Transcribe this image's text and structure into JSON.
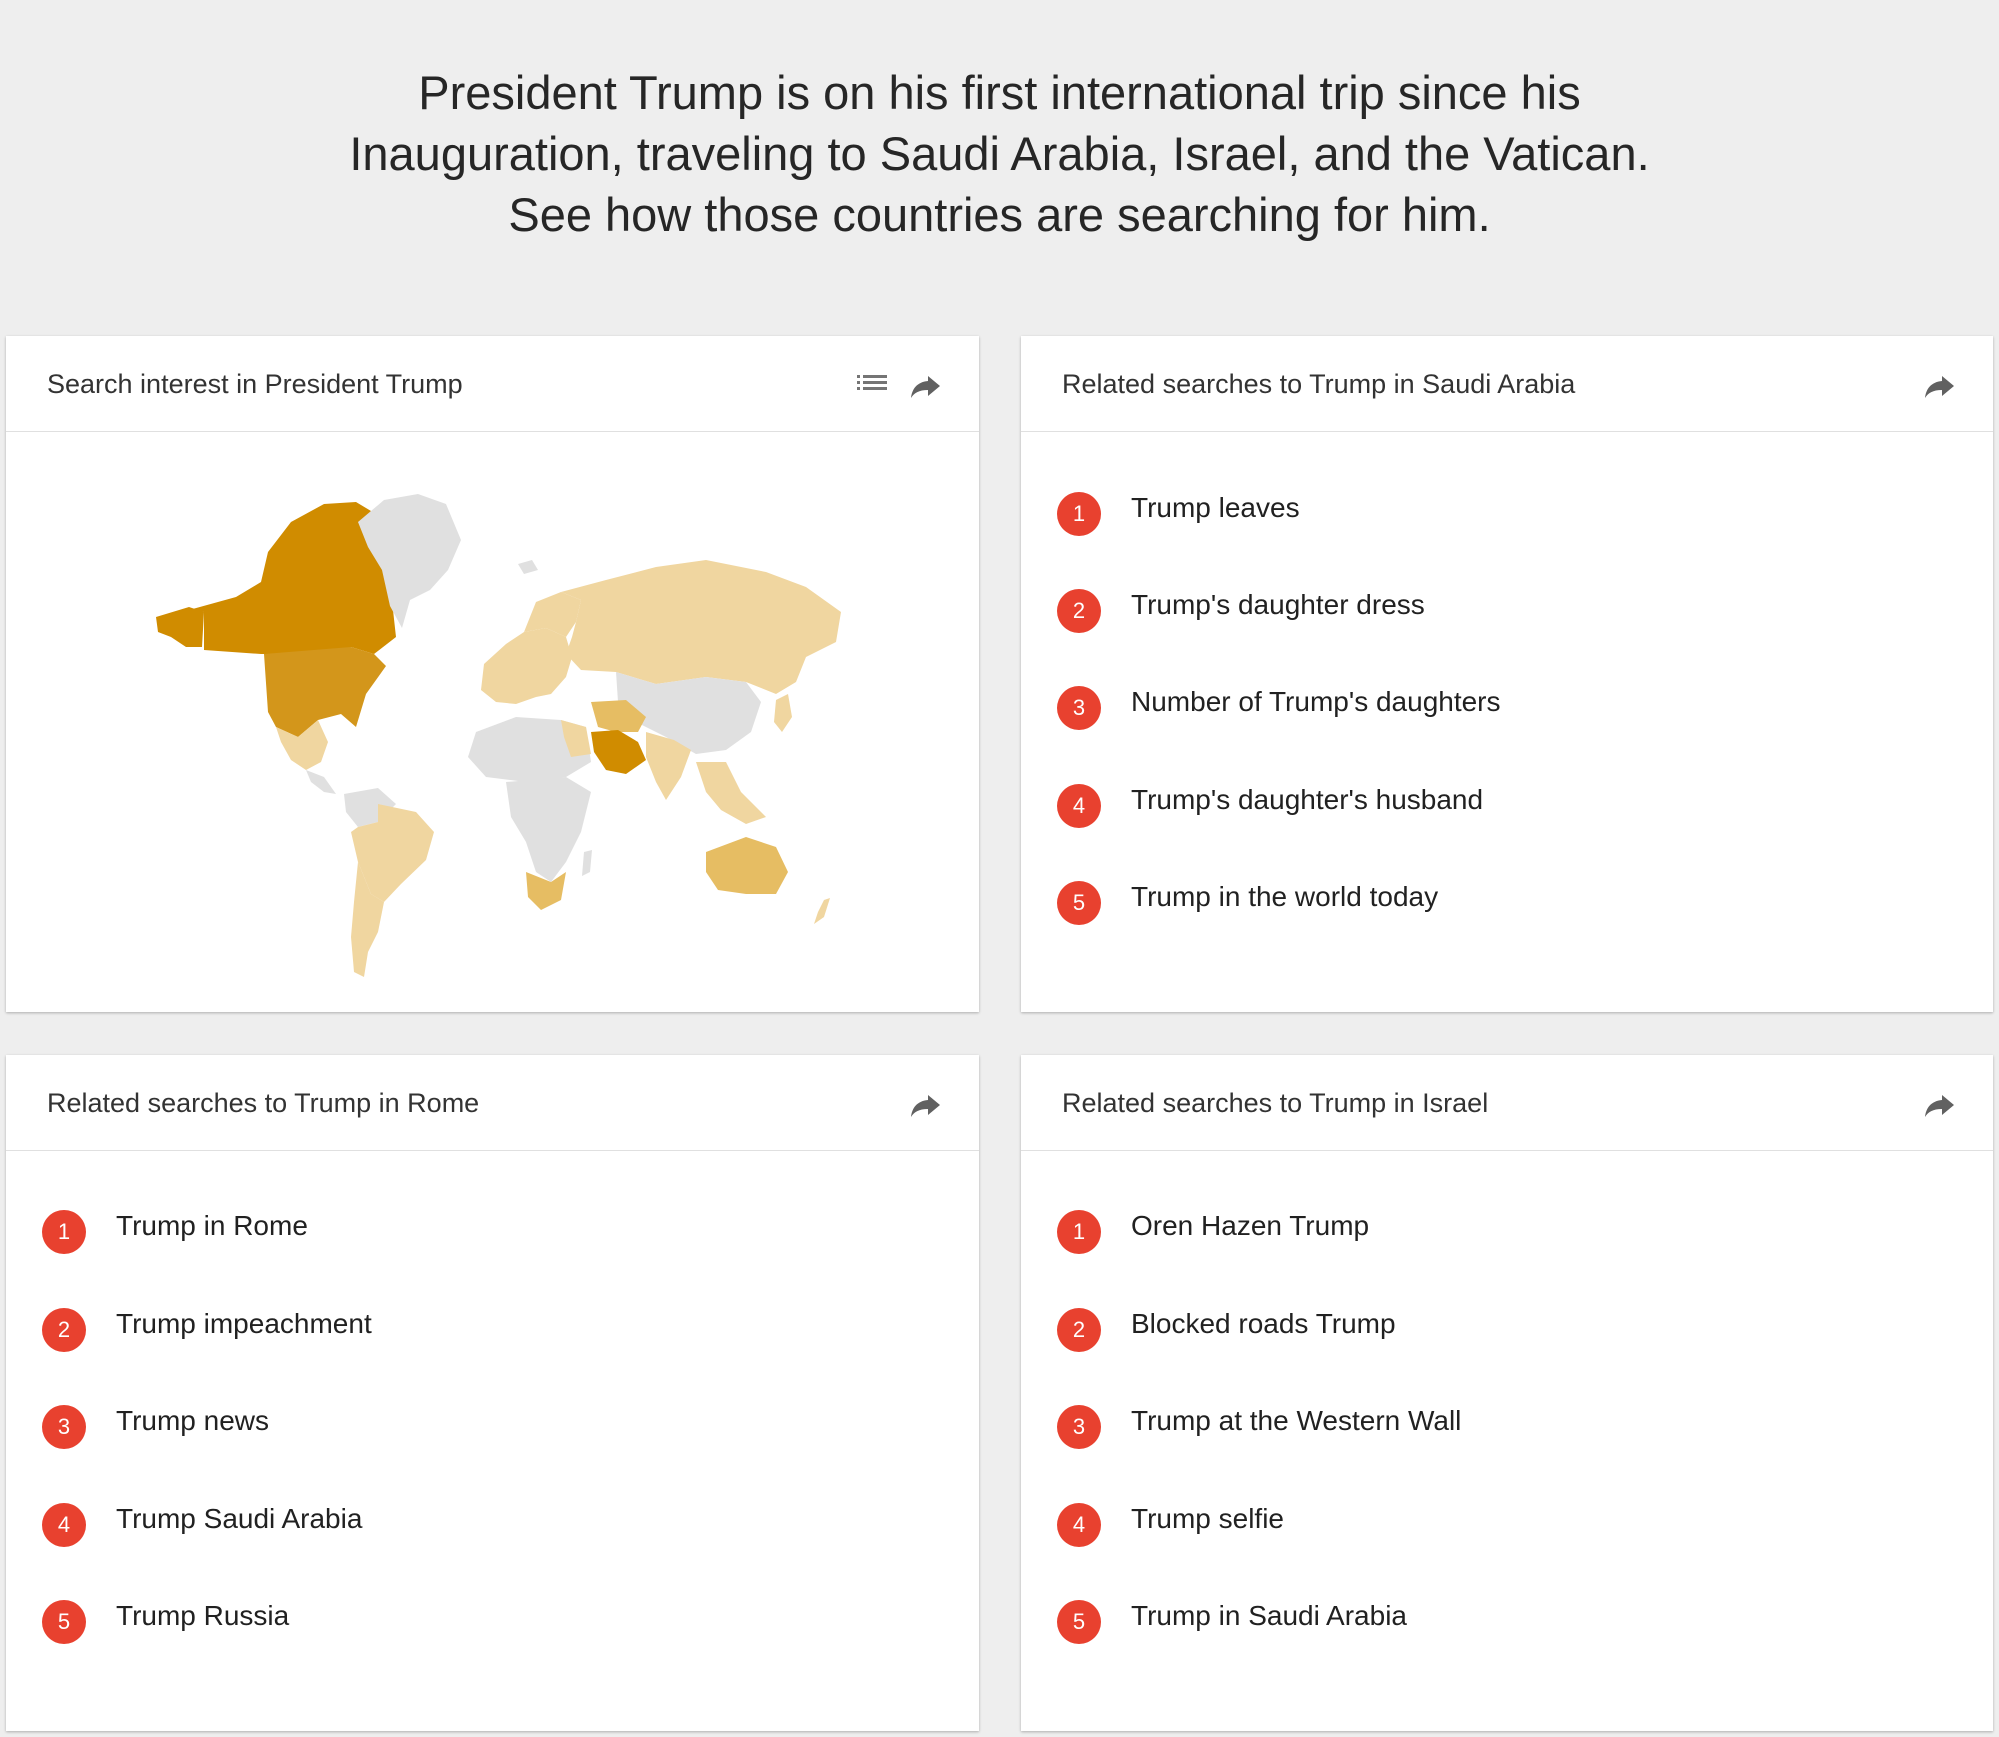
{
  "intro": {
    "line1": "President Trump is on his first international trip since his",
    "line2": "Inauguration, traveling to Saudi Arabia, Israel, and the Vatican.",
    "line3": "See how those countries are searching for him."
  },
  "colors": {
    "background": "#eeeeee",
    "card": "#ffffff",
    "rank_badge": "#e8412f",
    "map_high": "#d08c00",
    "map_mid": "#e6bd63",
    "map_low": "#f0d6a0",
    "map_none": "#e0e0e0"
  },
  "cards": {
    "map": {
      "title": "Search interest in President Trump",
      "icons": [
        "list-icon",
        "share-icon"
      ],
      "map_levels": {
        "United States": "high",
        "Canada": "high",
        "Saudi Arabia": "high",
        "Australia": "mid",
        "South Africa": "mid",
        "Russia": "low",
        "Mexico": "low",
        "Brazil": "low",
        "India": "low",
        "Europe": "low",
        "Greenland": "none",
        "China": "none"
      }
    },
    "saudi": {
      "title": "Related searches to Trump in Saudi Arabia",
      "icons": [
        "share-icon"
      ],
      "items": [
        {
          "rank": "1",
          "label": "Trump leaves"
        },
        {
          "rank": "2",
          "label": "Trump's daughter dress"
        },
        {
          "rank": "3",
          "label": "Number of Trump's daughters"
        },
        {
          "rank": "4",
          "label": "Trump's daughter's husband"
        },
        {
          "rank": "5",
          "label": "Trump in the world today"
        }
      ]
    },
    "rome": {
      "title": "Related searches to Trump in Rome",
      "icons": [
        "share-icon"
      ],
      "items": [
        {
          "rank": "1",
          "label": "Trump in Rome"
        },
        {
          "rank": "2",
          "label": "Trump impeachment"
        },
        {
          "rank": "3",
          "label": "Trump news"
        },
        {
          "rank": "4",
          "label": "Trump Saudi Arabia"
        },
        {
          "rank": "5",
          "label": "Trump Russia"
        }
      ]
    },
    "israel": {
      "title": "Related searches to Trump in Israel",
      "icons": [
        "share-icon"
      ],
      "items": [
        {
          "rank": "1",
          "label": "Oren Hazen Trump"
        },
        {
          "rank": "2",
          "label": "Blocked roads Trump"
        },
        {
          "rank": "3",
          "label": "Trump at the Western Wall"
        },
        {
          "rank": "4",
          "label": "Trump selfie"
        },
        {
          "rank": "5",
          "label": "Trump in Saudi Arabia"
        }
      ]
    }
  }
}
